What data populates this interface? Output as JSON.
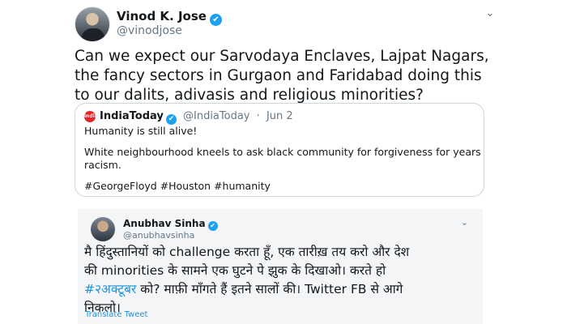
{
  "tweet": {
    "author_name": "Vinod K. Jose",
    "author_handle": "@vinodjose",
    "verified_mark": "✔",
    "menu_icon": "chevron-down-icon",
    "text_lines": [
      "Can we expect our Sarvodaya Enclaves, Lajpat Nagars,",
      "the fancy sectors in Gurgaon and Faridabad doing this",
      "to our dalits, adivasis and religious minorities?"
    ]
  },
  "quote": {
    "logo_text": "india today",
    "name": "IndiaToday",
    "verified_mark": "✔",
    "handle": "@IndiaToday",
    "separator": "·",
    "date": "Jun 2",
    "lines": [
      "Humanity is still alive!",
      "White neighbourhood kneels to ask black community for forgiveness for years of",
      "racism.",
      "#GeorgeFloyd #Houston #humanity"
    ]
  },
  "embedded": {
    "name": "Anubhav Sinha",
    "verified_mark": "✔",
    "handle": "@anubhavsinha",
    "line1": "मै हिंदुस्तानियों को challenge करता हूँ, एक तारीख़ तय करो और देश",
    "line2": "की minorities के सामने एक घुटने पे झुक के दिखाओ। करते हो",
    "line3_hashtag": "#२अक्टूबर",
    "line3_rest": " को? माफ़ी माँगते हैं इतने सालों की। Twitter FB से आगे",
    "line4": "निकलो।",
    "translate": "Translate Tweet"
  },
  "colors": {
    "link": "#1b95e0",
    "verified": "#1da1f2",
    "secondary_text": "#657786",
    "brand_red": "#e0262c"
  }
}
